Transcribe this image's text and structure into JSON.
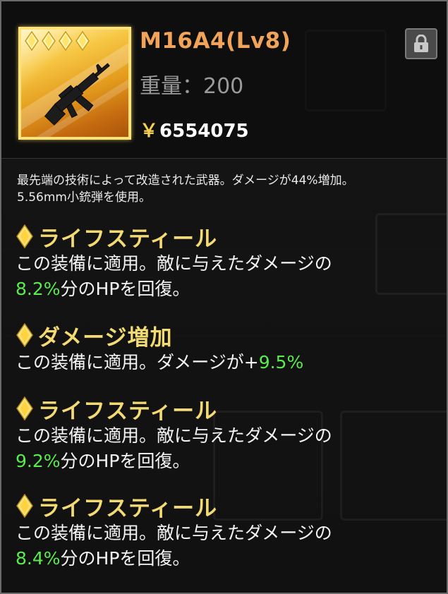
{
  "item": {
    "title": "M16A4(Lv8)",
    "weight_label": "重量：",
    "weight_value": "200",
    "price_symbol": "￥",
    "price_value": "6554075",
    "rarity_gems": 4,
    "image_icon": "rifle-icon",
    "lock_icon": "lock-icon",
    "frame_color": "#ffe37a"
  },
  "description": {
    "line1": "最先端の技術によって改造された武器。ダメージが44%増加。",
    "line2": "5.56mm小銃弾を使用。"
  },
  "skills": [
    {
      "name": "ライフスティール",
      "line1": "この装備に適用。敵に与えたダメージの",
      "value": "8.2%",
      "suffix": "分のHPを回復。"
    },
    {
      "name": "ダメージ増加",
      "prefix": "この装備に適用。ダメージが+",
      "value": "9.5%"
    },
    {
      "name": "ライフスティール",
      "line1": "この装備に適用。敵に与えたダメージの",
      "value": "9.2%",
      "suffix": "分のHPを回復。"
    },
    {
      "name": "ライフスティール",
      "line1": "この装備に適用。敵に与えたダメージの",
      "value": "8.4%",
      "suffix": "分のHPを回復。"
    }
  ],
  "colors": {
    "title": "#f2a35a",
    "skill_name": "#f3da72",
    "highlight_value": "#5bea4f",
    "gem": "#f6e27a"
  }
}
